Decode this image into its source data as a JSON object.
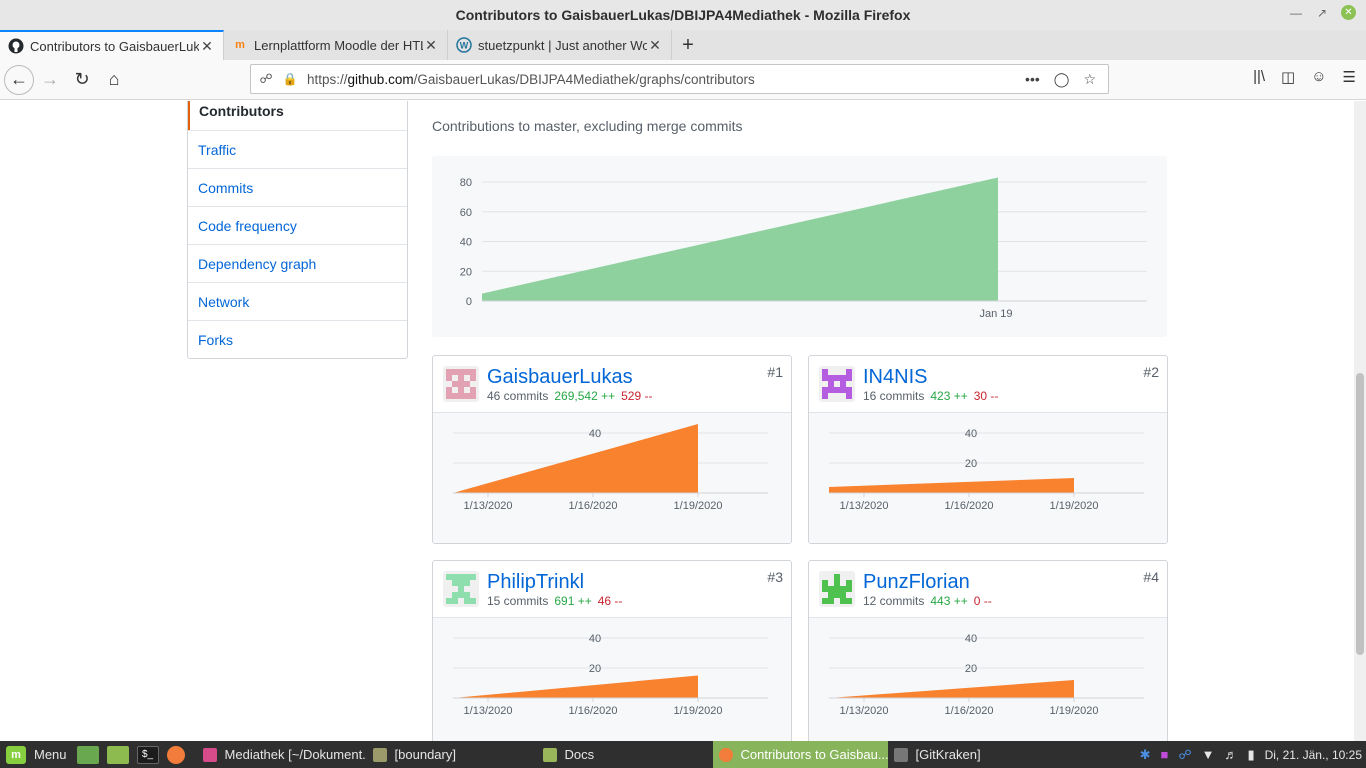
{
  "window": {
    "title": "Contributors to GaisbauerLukas/DBIJPA4Mediathek - Mozilla Firefox"
  },
  "tabs": [
    {
      "label": "Contributors to GaisbauerLukas/DBIJPA4Mediathek",
      "icon": "github-icon",
      "active": true
    },
    {
      "label": "Lernplattform Moodle der HTL Leonding",
      "icon": "moodle-icon",
      "active": false
    },
    {
      "label": "stuetzpunkt | Just another WordPress site",
      "icon": "wordpress-icon",
      "active": false
    }
  ],
  "navbar": {
    "url_prefix": "https://",
    "url_domain": "github.com",
    "url_path": "/GaisbauerLukas/DBIJPA4Mediathek/graphs/contributors"
  },
  "sidenav": {
    "items": [
      {
        "label": "Contributors",
        "selected": true
      },
      {
        "label": "Traffic"
      },
      {
        "label": "Commits"
      },
      {
        "label": "Code frequency"
      },
      {
        "label": "Dependency graph"
      },
      {
        "label": "Network"
      },
      {
        "label": "Forks"
      }
    ]
  },
  "main": {
    "subtitle": "Contributions to master, excluding merge commits"
  },
  "chart_data": [
    {
      "type": "area",
      "title": "",
      "x": [
        "start",
        "Jan 19"
      ],
      "values": [
        5,
        83
      ],
      "y_ticks": [
        0,
        20,
        40,
        60,
        80
      ],
      "x_ticks": [
        "Jan 19"
      ],
      "ylim": [
        0,
        85
      ],
      "grid": true,
      "color": "#8fd19e"
    },
    {
      "type": "area",
      "contributor": "GaisbauerLukas",
      "x": [
        "start",
        "1/19/2020"
      ],
      "values": [
        0,
        46
      ],
      "y_ticks": [
        40
      ],
      "x_ticks": [
        "1/13/2020",
        "1/16/2020",
        "1/19/2020"
      ],
      "ylim": [
        0,
        46
      ],
      "color": "#f9822e"
    },
    {
      "type": "area",
      "contributor": "IN4NIS",
      "x": [
        "start",
        "1/19/2020"
      ],
      "values": [
        4,
        10
      ],
      "y_ticks": [
        20,
        40
      ],
      "x_ticks": [
        "1/13/2020",
        "1/16/2020",
        "1/19/2020"
      ],
      "ylim": [
        0,
        46
      ],
      "color": "#f9822e"
    },
    {
      "type": "area",
      "contributor": "PhilipTrinkl",
      "x": [
        "start",
        "1/19/2020"
      ],
      "values": [
        0,
        15
      ],
      "y_ticks": [
        20,
        40
      ],
      "x_ticks": [
        "1/13/2020",
        "1/16/2020",
        "1/19/2020"
      ],
      "ylim": [
        0,
        46
      ],
      "color": "#f9822e"
    },
    {
      "type": "area",
      "contributor": "PunzFlorian",
      "x": [
        "start",
        "1/19/2020"
      ],
      "values": [
        0,
        12
      ],
      "y_ticks": [
        20,
        40
      ],
      "x_ticks": [
        "1/13/2020",
        "1/16/2020",
        "1/19/2020"
      ],
      "ylim": [
        0,
        46
      ],
      "color": "#f9822e"
    }
  ],
  "contributors": [
    {
      "name": "GaisbauerLukas",
      "commits": "46 commits",
      "additions": "269,542 ++",
      "deletions": "529 --",
      "rank": "#1",
      "avatar_color": "#e3a1b4"
    },
    {
      "name": "IN4NIS",
      "commits": "16 commits",
      "additions": "423 ++",
      "deletions": "30 --",
      "rank": "#2",
      "avatar_color": "#b55de0"
    },
    {
      "name": "PhilipTrinkl",
      "commits": "15 commits",
      "additions": "691 ++",
      "deletions": "46 --",
      "rank": "#3",
      "avatar_color": "#8fdfae"
    },
    {
      "name": "PunzFlorian",
      "commits": "12 commits",
      "additions": "443 ++",
      "deletions": "0 --",
      "rank": "#4",
      "avatar_color": "#4fc14f"
    }
  ],
  "taskbar": {
    "menu_label": "Menu",
    "tasks": [
      {
        "label": "Mediathek [~/Dokument...",
        "color": "#d64b8a"
      },
      {
        "label": "[boundary]",
        "color": "#9a9a6a"
      },
      {
        "label": "Docs",
        "color": "#9ab65a"
      },
      {
        "label": "Contributors to Gaisbau...",
        "color": "#f27d3a",
        "active": true
      },
      {
        "label": "[GitKraken]",
        "color": "#777"
      }
    ],
    "clock": "Di, 21. Jän., 10:25"
  }
}
